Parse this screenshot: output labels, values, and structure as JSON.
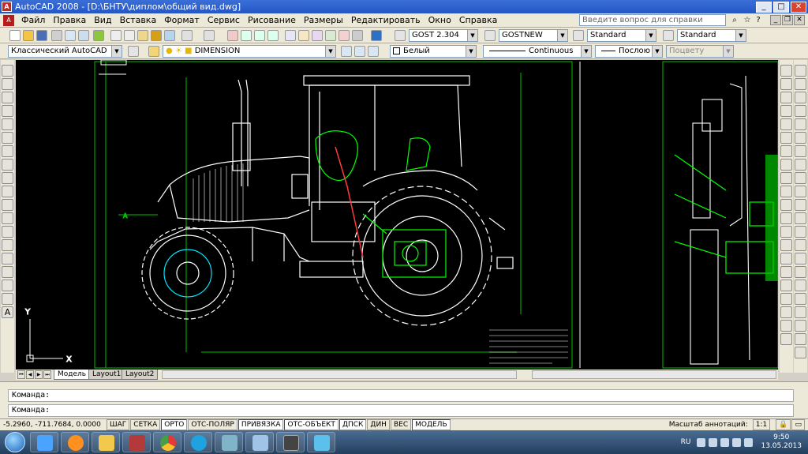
{
  "titlebar": {
    "title": "AutoCAD 2008 - [D:\\БНТУ\\диплом\\общий вид.dwg]",
    "minimize": "_",
    "maximize": "□",
    "close": "✕"
  },
  "menubar": {
    "items": [
      "Файл",
      "Правка",
      "Вид",
      "Вставка",
      "Формат",
      "Сервис",
      "Рисование",
      "Размеры",
      "Редактировать",
      "Окно",
      "Справка"
    ],
    "help_placeholder": "Введите вопрос для справки"
  },
  "toolbar1": {
    "text_style_value": "GOST 2.304",
    "dim_style_value": "GOSTNEW",
    "table_style_value": "Standard",
    "multileader_style_value": "Standard"
  },
  "toolbar2": {
    "workspace_value": "Классический AutoCAD",
    "layer_value": "DIMENSION",
    "color_value": "Белый",
    "linetype_value": "Continuous",
    "lineweight_value": "Послою",
    "plotstyle_value": "Поцвету"
  },
  "canvas": {
    "ucs_x_label": "X",
    "ucs_y_label": "Y",
    "zone_label": "A",
    "colors": {
      "background": "#000000",
      "lines": "#ffffff",
      "frame": "#00c000",
      "accent": "#00ff00",
      "callout": "#ff3b3b"
    }
  },
  "tabs": [
    "Модель",
    "Layout1",
    "Layout2"
  ],
  "command": {
    "line1": "Команда:",
    "line2": "Команда:"
  },
  "status": {
    "coords": "-5.2960, -711.7684, 0.0000",
    "buttons": [
      "ШАГ",
      "СЕТКА",
      "ОРТО",
      "ОТС-ПОЛЯР",
      "ПРИВЯЗКА",
      "ОТС-ОБЪЕКТ",
      "ДПСК",
      "ДИН",
      "ВЕС",
      "МОДЕЛЬ"
    ],
    "annotation_scale_label": "Масштаб аннотаций:",
    "annotation_scale_value": "1:1"
  },
  "taskbar": {
    "lang": "RU",
    "time": "9:50",
    "date": "13.05.2013"
  }
}
